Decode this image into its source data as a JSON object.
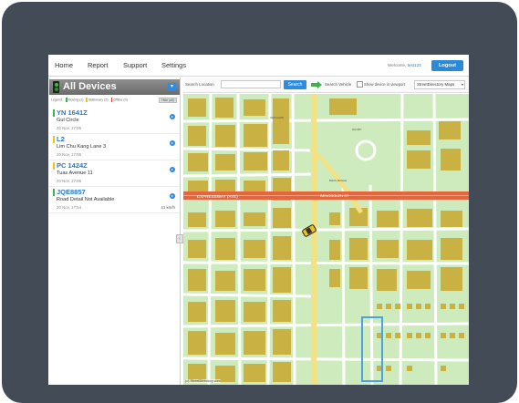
{
  "nav": {
    "items": [
      "Home",
      "Report",
      "Support",
      "Settings"
    ],
    "welcome_prefix": "Welcome,",
    "username": "test123",
    "logout_label": "Logout"
  },
  "sidebar": {
    "title": "All Devices",
    "legend": {
      "label": "Legend:",
      "moving": "Moving (1)",
      "stationary": "Stationary (3)",
      "offline": "Offline (0)",
      "hide_label": "Hide (all)"
    },
    "devices": [
      {
        "name": "YN 1641Z",
        "location": "Gul Circle",
        "time": "20 Nov, 17:05",
        "speed": "",
        "color": "#3cb54a"
      },
      {
        "name": "L2",
        "location": "Lim Chu Kang Lane 3",
        "time": "20 Nov, 17:05",
        "speed": "",
        "color": "#f2c21b"
      },
      {
        "name": "PC 1424Z",
        "location": "Tuas Avenue 11",
        "time": "20 Nov, 17:05",
        "speed": "",
        "color": "#f2c21b"
      },
      {
        "name": "JQE8857",
        "location": "Road Detail Not Available",
        "time": "20 Nov, 17:54",
        "speed": "41 km/h",
        "color": "#3cb54a"
      }
    ],
    "speed_default": "0 km/h"
  },
  "maptoolbar": {
    "search_label": "Search Location",
    "search_placeholder": "",
    "search_button": "Search",
    "search_vehicle": "Search Vehicle",
    "show_in_viewport": "Show device in viewport",
    "map_provider": "StreetDirectory Maps"
  },
  "map": {
    "labels": [
      "EXPRESSWAY (AYE)",
      "BENCOOLEN ST",
      "ORCHARD",
      "DHOBY",
      "BRAS BASAH"
    ],
    "attribution": "(c) StreetDirectory.com",
    "colors": {
      "park": "#cdebbd",
      "road": "#ffffff",
      "major_road": "#f4e183",
      "building": "#c9b144",
      "expressway": "#e8643a"
    }
  }
}
